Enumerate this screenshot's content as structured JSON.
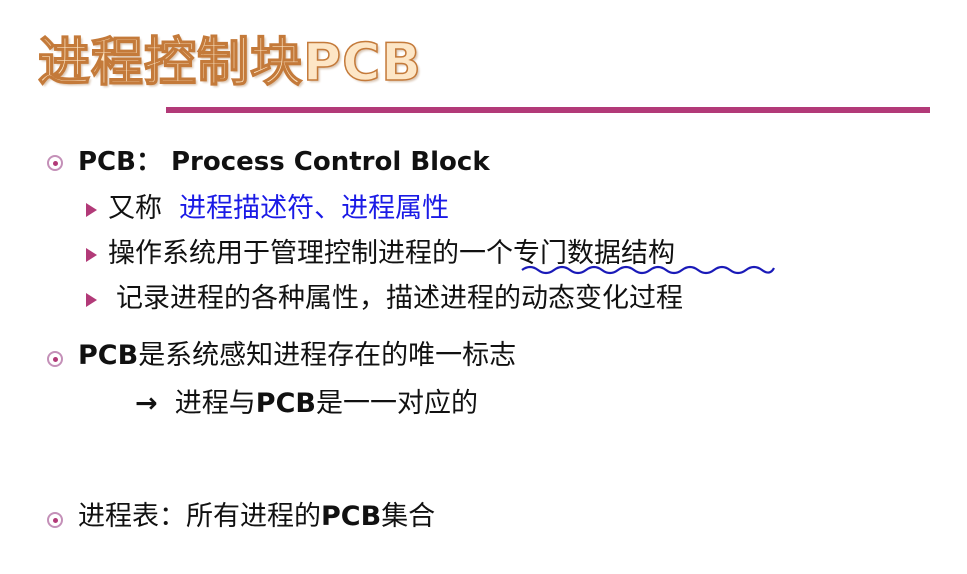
{
  "title": "进程控制块PCB",
  "bullets": {
    "b1": {
      "text": "PCB： Process  Control Block",
      "subs": {
        "s1_prefix": "又称",
        "s1_highlight": "进程描述符、进程属性",
        "s2_prefix": "操作系统用于管理控制进程的",
        "s2_underlined": "一个专门数据结构",
        "s3": "记录进程的各种属性，描述进程的动态变化过程"
      }
    },
    "b2": {
      "prefix": "PCB",
      "rest": "是系统感知进程存在的唯一标志",
      "arrow": "→",
      "arrow_prefix": "进程与",
      "arrow_pcb": "PCB",
      "arrow_rest": "是一一对应的"
    },
    "b3": {
      "prefix": "进程表：所有进程的",
      "pcb": "PCB",
      "rest": "集合"
    }
  },
  "colors": {
    "accent": "#b23a78",
    "highlight_blue": "#1a1ae6",
    "title_fill": "#fde6c6",
    "title_stroke": "#c47a3a"
  }
}
